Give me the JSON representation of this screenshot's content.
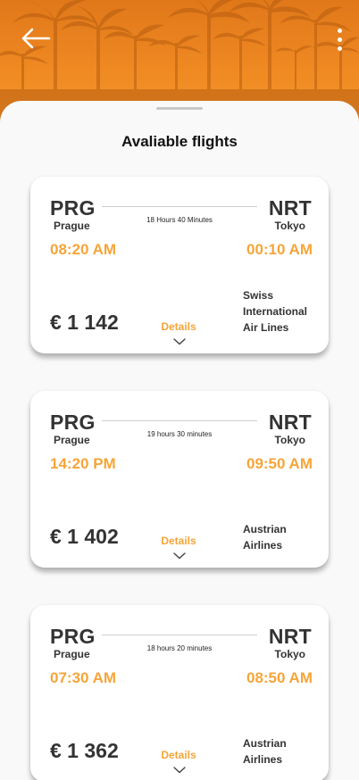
{
  "header": {
    "back_icon": "arrow-left-icon",
    "menu_icon": "more-vertical-icon"
  },
  "sheet": {
    "title": "Avaliable flights"
  },
  "colors": {
    "accent": "#f5a53a",
    "hero_top": "#e0781a",
    "hero_bottom": "#f59a30",
    "text": "#333333"
  },
  "flights": [
    {
      "from_code": "PRG",
      "from_city": "Prague",
      "to_code": "NRT",
      "to_city": "Tokyo",
      "duration": "18 Hours 40 Minutes",
      "depart_time": "08:20 AM",
      "arrive_time": "00:10 AM",
      "price": "€ 1 142",
      "airline": "Swiss International Air Lines",
      "details_label": "Details"
    },
    {
      "from_code": "PRG",
      "from_city": "Prague",
      "to_code": "NRT",
      "to_city": "Tokyo",
      "duration": "19 hours 30 minutes",
      "depart_time": "14:20 PM",
      "arrive_time": "09:50 AM",
      "price": "€ 1 402",
      "airline": "Austrian Airlines",
      "details_label": "Details"
    },
    {
      "from_code": "PRG",
      "from_city": "Prague",
      "to_code": "NRT",
      "to_city": "Tokyo",
      "duration": "18 hours 20 minutes",
      "depart_time": "07:30 AM",
      "arrive_time": "08:50 AM",
      "price": "€ 1 362",
      "airline": "Austrian Airlines",
      "details_label": "Details"
    }
  ]
}
